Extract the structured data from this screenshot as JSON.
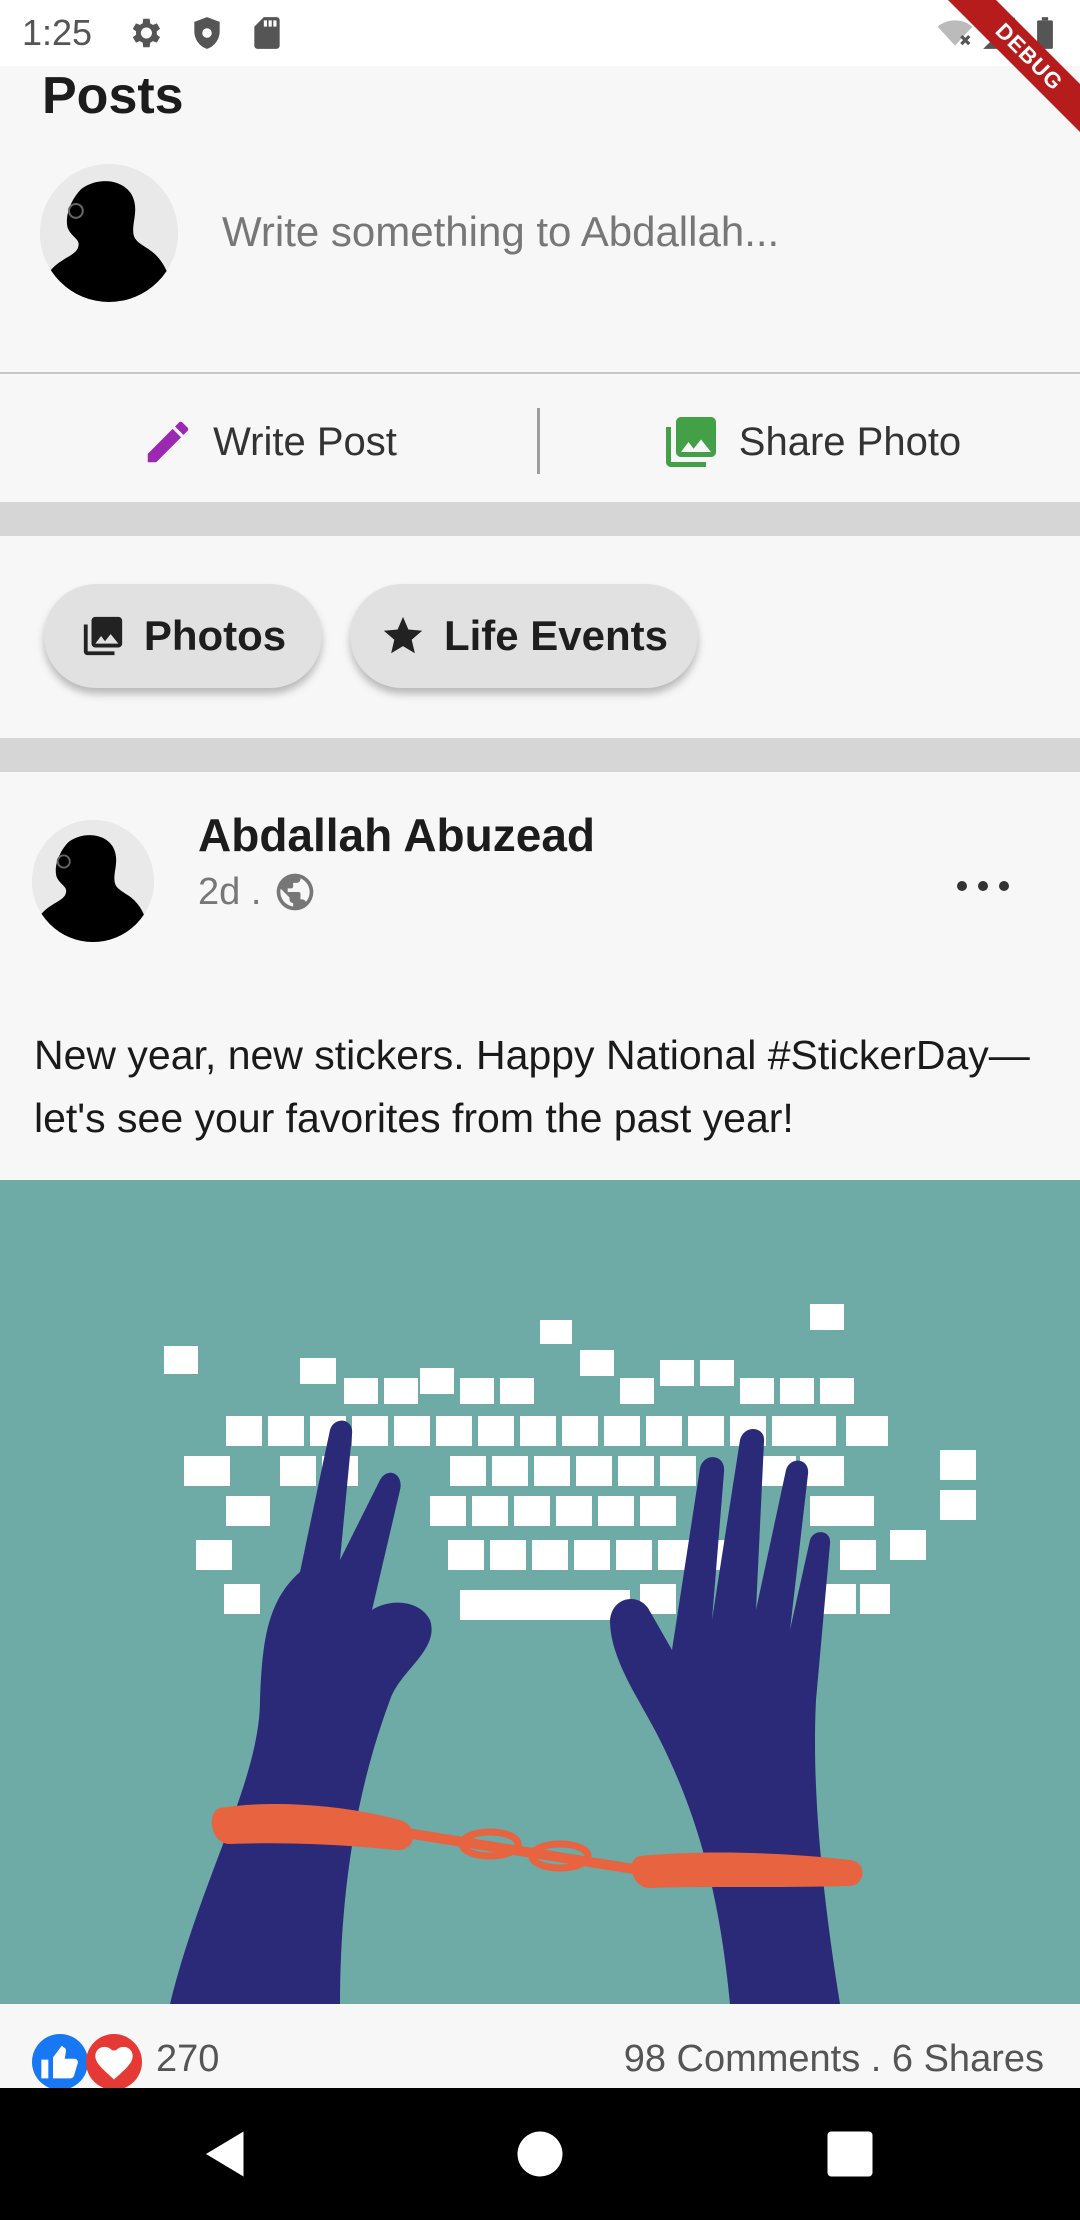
{
  "status_bar": {
    "time": "1:25",
    "icons": [
      "gear-icon",
      "shield-icon",
      "sd-card-icon",
      "wifi-off-icon",
      "signal-icon",
      "battery-icon"
    ]
  },
  "debug_banner": "DEBUG",
  "posts": {
    "title": "Posts",
    "composer_placeholder": "Write something to Abdallah...",
    "actions": {
      "write_post": "Write Post",
      "share_photo": "Share Photo"
    },
    "chips": {
      "photos": "Photos",
      "life_events": "Life Events"
    }
  },
  "post": {
    "author": "Abdallah Abuzead",
    "time": "2d .",
    "text": "New year, new stickers. Happy National #StickerDay—let's see your favorites from the past year!",
    "reactions_count": "270",
    "stats": "98 Comments . 6 Shares"
  },
  "colors": {
    "write_icon": "#9c27b0",
    "photo_icon": "#43a047",
    "like": "#1877f2",
    "love": "#e53935",
    "image_bg": "#6eaaa6"
  }
}
